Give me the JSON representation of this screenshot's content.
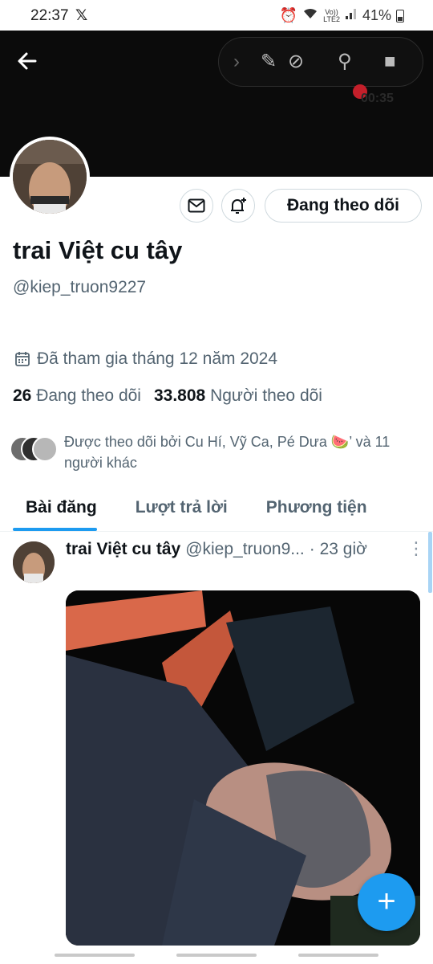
{
  "status_bar": {
    "time": "22:37",
    "x_logo": "𝕏",
    "network": "Vo))",
    "network_sub": "LTE2",
    "battery": "41%"
  },
  "screen_recorder": {
    "timer": "00:35"
  },
  "profile": {
    "follow_button_label": "Đang theo dõi",
    "display_name": "trai Việt cu tây",
    "handle": "@kiep_truon9227",
    "joined": "Đã tham gia tháng 12 năm 2024",
    "following_count": "26",
    "following_label": "Đang theo dõi",
    "followers_count": "33.808",
    "followers_label": "Người theo dõi",
    "followed_by_text": "Được theo dõi bởi Cu Hí, Vỹ Ca, Pé Dưa 🍉’ và 11 người khác"
  },
  "tabs": [
    {
      "label": "Bài đăng",
      "active": true
    },
    {
      "label": "Lượt trả lời",
      "active": false
    },
    {
      "label": "Phương tiện",
      "active": false
    }
  ],
  "post": {
    "author_name": "trai Việt cu tây",
    "author_handle": "@kiep_truon9...",
    "time": "· 23 giờ",
    "more": "⋮"
  },
  "colors": {
    "accent": "#1d9bf0",
    "text_primary": "#0f1419",
    "text_secondary": "#536471",
    "banner": "#0b0b0b"
  },
  "icons": {
    "back": "arrow-left-icon",
    "message": "envelope-icon",
    "notify": "bell-plus-icon",
    "calendar": "calendar-icon",
    "compose": "plus-icon"
  }
}
